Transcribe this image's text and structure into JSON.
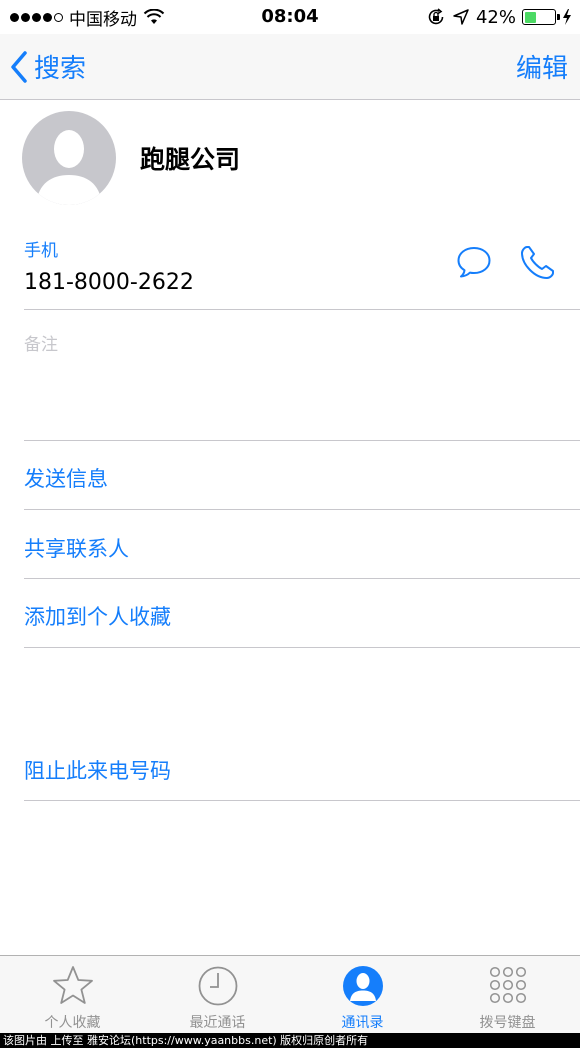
{
  "status_bar": {
    "carrier": "中国移动",
    "time": "08:04",
    "battery_text": "42%",
    "battery_level": 0.42,
    "battery_color": "#4cd964"
  },
  "nav": {
    "back_label": "搜索",
    "edit_label": "编辑",
    "accent_color": "#157efb"
  },
  "contact": {
    "name": "跑腿公司",
    "phone_label": "手机",
    "phone_number": "181-8000-2622",
    "notes_label": "备注"
  },
  "actions": {
    "send_message": "发送信息",
    "share_contact": "共享联系人",
    "add_favorite": "添加到个人收藏",
    "block_caller": "阻止此来电号码"
  },
  "tabs": [
    {
      "label": "个人收藏",
      "icon": "star-icon",
      "active": false
    },
    {
      "label": "最近通话",
      "icon": "clock-icon",
      "active": false
    },
    {
      "label": "通讯录",
      "icon": "contacts-icon",
      "active": true
    },
    {
      "label": "拨号键盘",
      "icon": "keypad-icon",
      "active": false
    }
  ],
  "watermark": "该图片由 上传至 雅安论坛(https://www.yaanbbs.net) 版权归原创者所有"
}
